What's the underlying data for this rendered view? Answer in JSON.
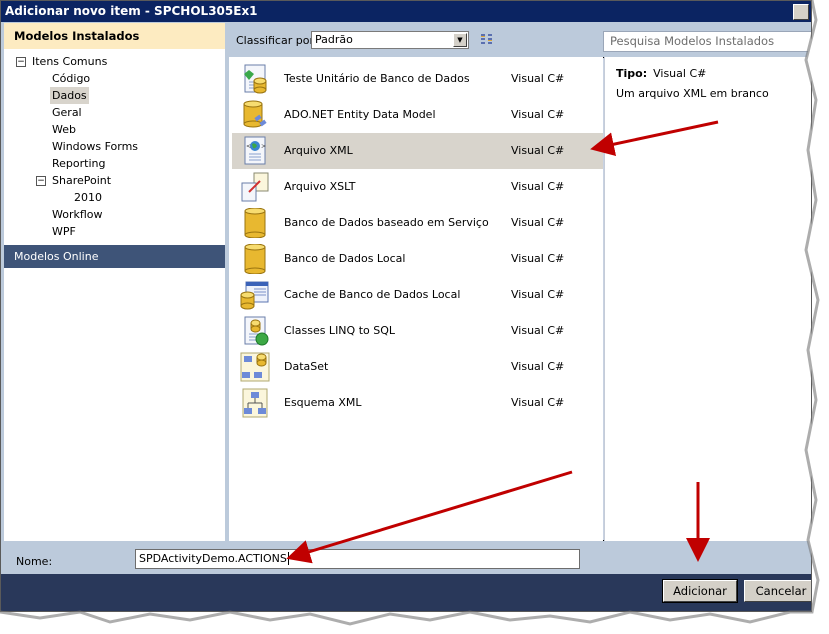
{
  "window": {
    "title": "Adicionar novo item - SPCHOL305Ex1"
  },
  "left_panel": {
    "header": "Modelos Instalados",
    "tree": [
      {
        "label": "Itens Comuns",
        "level": 0,
        "expander": "−"
      },
      {
        "label": "Código",
        "level": 1
      },
      {
        "label": "Dados",
        "level": 1,
        "selected": true
      },
      {
        "label": "Geral",
        "level": 1
      },
      {
        "label": "Web",
        "level": 1
      },
      {
        "label": "Windows Forms",
        "level": 1
      },
      {
        "label": "Reporting",
        "level": 1
      },
      {
        "label": "SharePoint",
        "level": 1,
        "expander": "−"
      },
      {
        "label": "2010",
        "level": 2
      },
      {
        "label": "Workflow",
        "level": 1
      },
      {
        "label": "WPF",
        "level": 1
      }
    ],
    "online": "Modelos Online"
  },
  "toolbar": {
    "sort_label": "Classificar por:",
    "sort_value": "Padrão",
    "dropdown_icon": "chevron-down-icon",
    "view_small_icon": "small-icons-view-icon",
    "view_list_icon": "list-view-icon",
    "search_placeholder": "Pesquisa Modelos Instalados"
  },
  "items": [
    {
      "name": "Teste Unitário de Banco de Dados",
      "lang": "Visual C#",
      "icon": "database-unit-test-icon"
    },
    {
      "name": "ADO.NET Entity Data Model",
      "lang": "Visual C#",
      "icon": "entity-data-model-icon"
    },
    {
      "name": "Arquivo XML",
      "lang": "Visual C#",
      "icon": "xml-file-icon",
      "selected": true
    },
    {
      "name": "Arquivo XSLT",
      "lang": "Visual C#",
      "icon": "xslt-file-icon"
    },
    {
      "name": "Banco de Dados baseado em Serviço",
      "lang": "Visual C#",
      "icon": "database-icon"
    },
    {
      "name": "Banco de Dados Local",
      "lang": "Visual C#",
      "icon": "database-icon"
    },
    {
      "name": "Cache de Banco de Dados Local",
      "lang": "Visual C#",
      "icon": "database-cache-icon"
    },
    {
      "name": "Classes LINQ to SQL",
      "lang": "Visual C#",
      "icon": "linq-to-sql-icon"
    },
    {
      "name": "DataSet",
      "lang": "Visual C#",
      "icon": "dataset-icon"
    },
    {
      "name": "Esquema XML",
      "lang": "Visual C#",
      "icon": "xml-schema-icon"
    }
  ],
  "details": {
    "type_label": "Tipo:",
    "type_value": "Visual C#",
    "description": "Um arquivo XML em branco"
  },
  "bottom": {
    "name_label": "Nome:",
    "name_value": "SPDActivityDemo.ACTIONS",
    "add_button": "Adicionar",
    "cancel_button": "Cancelar"
  },
  "colors": {
    "title_bar": "#0b2462",
    "panel_header": "#fdebc1",
    "online_header": "#3e5478",
    "selection": "#d8d4cc",
    "annotation_arrow": "#c00000"
  }
}
